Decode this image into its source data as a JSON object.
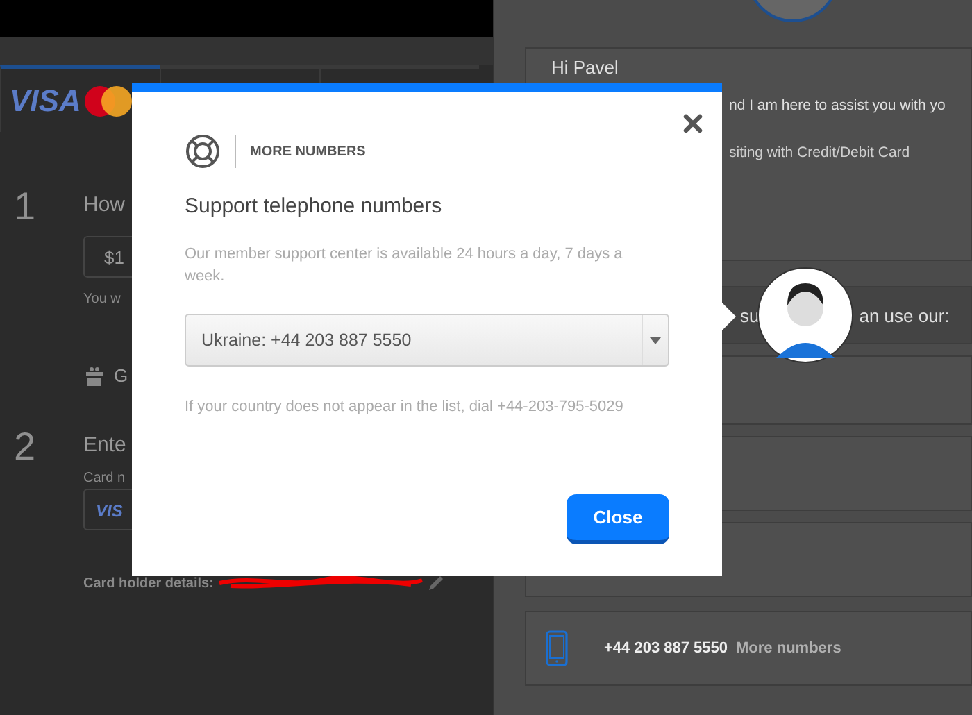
{
  "background_page": {
    "tabs": [
      {
        "logo": "VISA",
        "selected": true
      },
      {
        "selected": false
      },
      {
        "selected": false
      }
    ],
    "step_1": {
      "number": "1",
      "title": "How",
      "amount_field": "$1",
      "hint": "You w",
      "gift_link": "G"
    },
    "step_2": {
      "number": "2",
      "title": "Ente",
      "card_label": "Card n",
      "card_field": "VIS",
      "card_holder_label": "Card holder details:"
    }
  },
  "chat": {
    "greeting": "Hi Pavel",
    "message": "nd I am here to assist you with yo",
    "topic": "siting with Credit/Debit Card",
    "prompt_start": "su",
    "prompt_end": "an use our:",
    "phone_number": "+44 203 887 5550",
    "more_numbers_link": "More numbers"
  },
  "modal": {
    "section_label": "MORE NUMBERS",
    "title": "Support telephone numbers",
    "description": "Our member support center is available 24 hours a day, 7 days a week.",
    "number_select": {
      "value": "Ukraine: +44 203 887 5550"
    },
    "note": "If your country does not appear in the list, dial +44-203-795-5029",
    "close_button": "Close"
  }
}
